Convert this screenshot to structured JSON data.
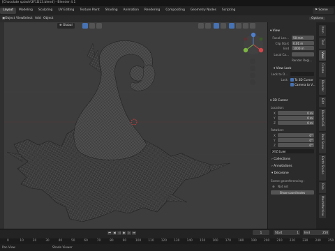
{
  "window": {
    "title": "[Chocolate splash\\3F1D13.blend] - Blender 4.1"
  },
  "workspaces": {
    "tabs": [
      "Layout",
      "Modeling",
      "Sculpting",
      "UV Editing",
      "Texture Paint",
      "Shading",
      "Animation",
      "Rendering",
      "Compositing",
      "Geometry Nodes",
      "Scripting"
    ],
    "active": 0,
    "scene": "Scene"
  },
  "header": {
    "mode": "Object",
    "view": "View",
    "select": "Select",
    "add": "Add",
    "object": "Object",
    "transform": "Global",
    "options": "Options"
  },
  "npanel": {
    "view_section": "View",
    "focal_length_label": "Focal Len...",
    "focal_length": "50 mm",
    "clip_start_label": "Clip Start",
    "clip_start": "0.01 m",
    "clip_end_label": "End",
    "clip_end": "1000 m",
    "local_camera_label": "Local Ca...",
    "render_region_label": "Render Regi...",
    "view_lock_section": "View Lock",
    "lock_to_object_label": "Lock to O...",
    "lock_label": "Lock",
    "to_3d_cursor_label": "To 3D Cursor",
    "camera_to_view_label": "Camera to V...",
    "cursor_section": "3D Cursor",
    "location_label": "Location:",
    "loc_x_label": "X",
    "loc_x": "0 m",
    "loc_y_label": "Y",
    "loc_y": "0 m",
    "loc_z_label": "Z",
    "loc_z": "0 m",
    "rotation_label": "Rotation:",
    "rot_x_label": "X",
    "rot_x": "0°",
    "rot_y_label": "Y",
    "rot_y": "0°",
    "rot_z_label": "Z",
    "rot_z": "0°",
    "rotation_mode": "XYZ Euler",
    "collections_section": "Collections",
    "annotations_section": "Annotations",
    "decorone_section": "Decorone",
    "scene_georef_label": "Scene georeferencing :",
    "not_set_label": "Not set",
    "show_coordinates": "Show coordinates"
  },
  "sidebar_tabs": [
    "Item",
    "Tool",
    "View",
    "Create",
    "Blender",
    "Edit",
    "BlenderGIS",
    "Real Snow",
    "Earth Studio",
    "Pole",
    "MeshMachine"
  ],
  "timeline": {
    "current_frame": "1",
    "start_label": "Start",
    "start": "1",
    "end_label": "End",
    "end": "250",
    "ruler": [
      "0",
      "10",
      "20",
      "30",
      "40",
      "50",
      "60",
      "70",
      "80",
      "90",
      "100",
      "110",
      "120",
      "130",
      "140",
      "150",
      "160",
      "170",
      "180",
      "190",
      "200",
      "210",
      "220",
      "230",
      "240",
      "250"
    ]
  },
  "status": {
    "left": "Pan View",
    "right": "Shade Viewer"
  },
  "colors": {
    "accent": "#4772b3",
    "viewport_bg": "#3d3d3d",
    "panel_bg": "#2b2b2b"
  }
}
